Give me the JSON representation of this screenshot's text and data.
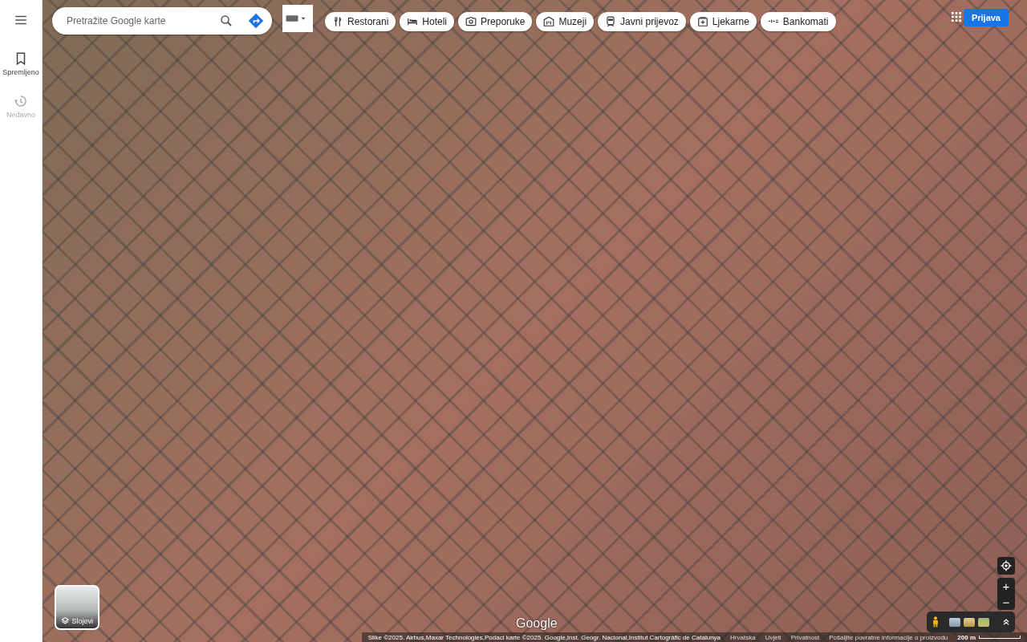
{
  "sidebar": {
    "items": [
      {
        "kind": "saved",
        "label": "Spremljeno",
        "disabled": false
      },
      {
        "kind": "recent",
        "label": "Nedavno",
        "disabled": true
      }
    ]
  },
  "search": {
    "placeholder": "Pretražite Google karte"
  },
  "chips": [
    {
      "kind": "restaurant",
      "label": "Restorani"
    },
    {
      "kind": "hotel",
      "label": "Hoteli"
    },
    {
      "kind": "camera",
      "label": "Preporuke"
    },
    {
      "kind": "museum",
      "label": "Muzeji"
    },
    {
      "kind": "transit",
      "label": "Javni prijevoz"
    },
    {
      "kind": "pharmacy",
      "label": "Ljekarne"
    },
    {
      "kind": "atm",
      "label": "Bankomati"
    }
  ],
  "account": {
    "sign_in": "Prijava"
  },
  "layers": {
    "label": "Slojevi"
  },
  "zoom": {
    "in": "+",
    "out": "−"
  },
  "logo": "Google",
  "footer": {
    "attribution": "Slike ©2025. Airbus,Maxar Technologies,Podaci karte ©2025. Google,Inst. Geogr. Nacional,Institut Cartogràfic de Catalunya",
    "links": [
      "Hrvatska",
      "Uvjeti",
      "Privatnost",
      "Pošaljite povratne informacije o proizvodu"
    ],
    "scale": "200 m"
  }
}
